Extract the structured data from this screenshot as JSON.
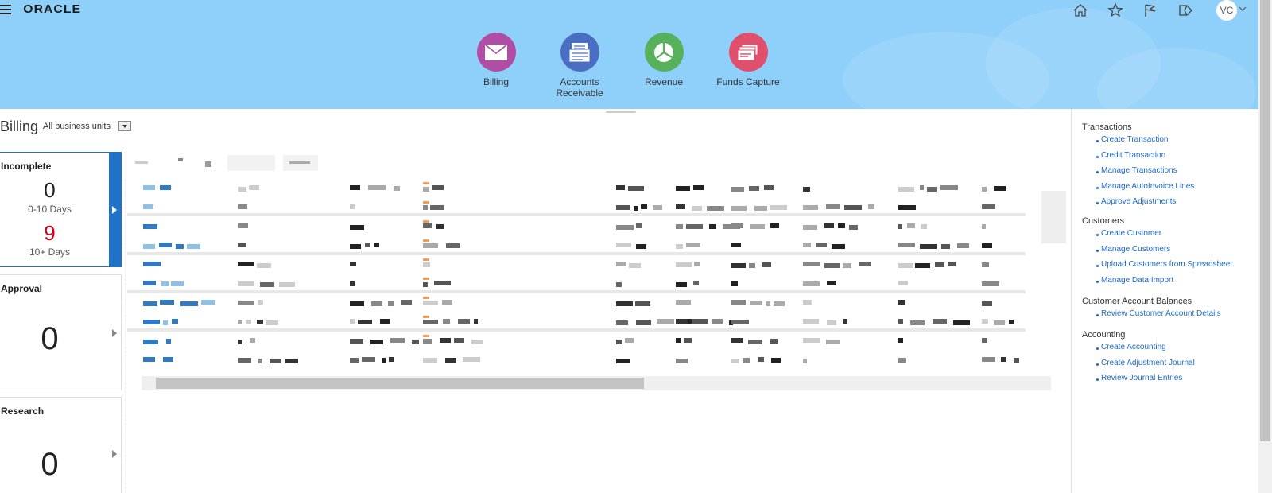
{
  "header": {
    "logo": "ORACLE",
    "avatar_initials": "VC",
    "icons": [
      "home-icon",
      "favorites-star-icon",
      "notifications-flag-icon",
      "watchlist-icon"
    ],
    "apps": [
      {
        "label": "Billing",
        "color": "#b24da5",
        "icon": "envelope-icon"
      },
      {
        "label": "Accounts Receivable",
        "color": "#4a6fc2",
        "icon": "invoice-icon"
      },
      {
        "label": "Revenue",
        "color": "#57b05a",
        "icon": "pie-chart-icon"
      },
      {
        "label": "Funds Capture",
        "color": "#e0506d",
        "icon": "payment-cards-icon"
      }
    ]
  },
  "billing": {
    "title": "Billing",
    "business_unit": "All business units"
  },
  "cards": {
    "incomplete": {
      "title": "Incomplete",
      "count_recent": "0",
      "label_recent": "0-10 Days",
      "count_old": "9",
      "label_old": "10+ Days"
    },
    "approval": {
      "title": "Approval",
      "count": "0"
    },
    "research": {
      "title": "Research",
      "count": "0"
    }
  },
  "tasks": {
    "transactions": {
      "heading": "Transactions",
      "items": [
        "Create Transaction",
        "Credit Transaction",
        "Manage Transactions",
        "Manage AutoInvoice Lines",
        "Approve Adjustments"
      ]
    },
    "customers": {
      "heading": "Customers",
      "items": [
        "Create Customer",
        "Manage Customers",
        "Upload Customers from Spreadsheet",
        "Manage Data Import"
      ]
    },
    "balances": {
      "heading": "Customer Account Balances",
      "items": [
        "Review Customer Account Details"
      ]
    },
    "accounting": {
      "heading": "Accounting",
      "items": [
        "Create Accounting",
        "Create Adjustment Journal",
        "Review Journal Entries"
      ]
    }
  },
  "colors": {
    "header_bg": "#8fd0fb",
    "link": "#1e6ac8",
    "highlight": "#f6f60a",
    "alert_red": "#d0021b"
  }
}
